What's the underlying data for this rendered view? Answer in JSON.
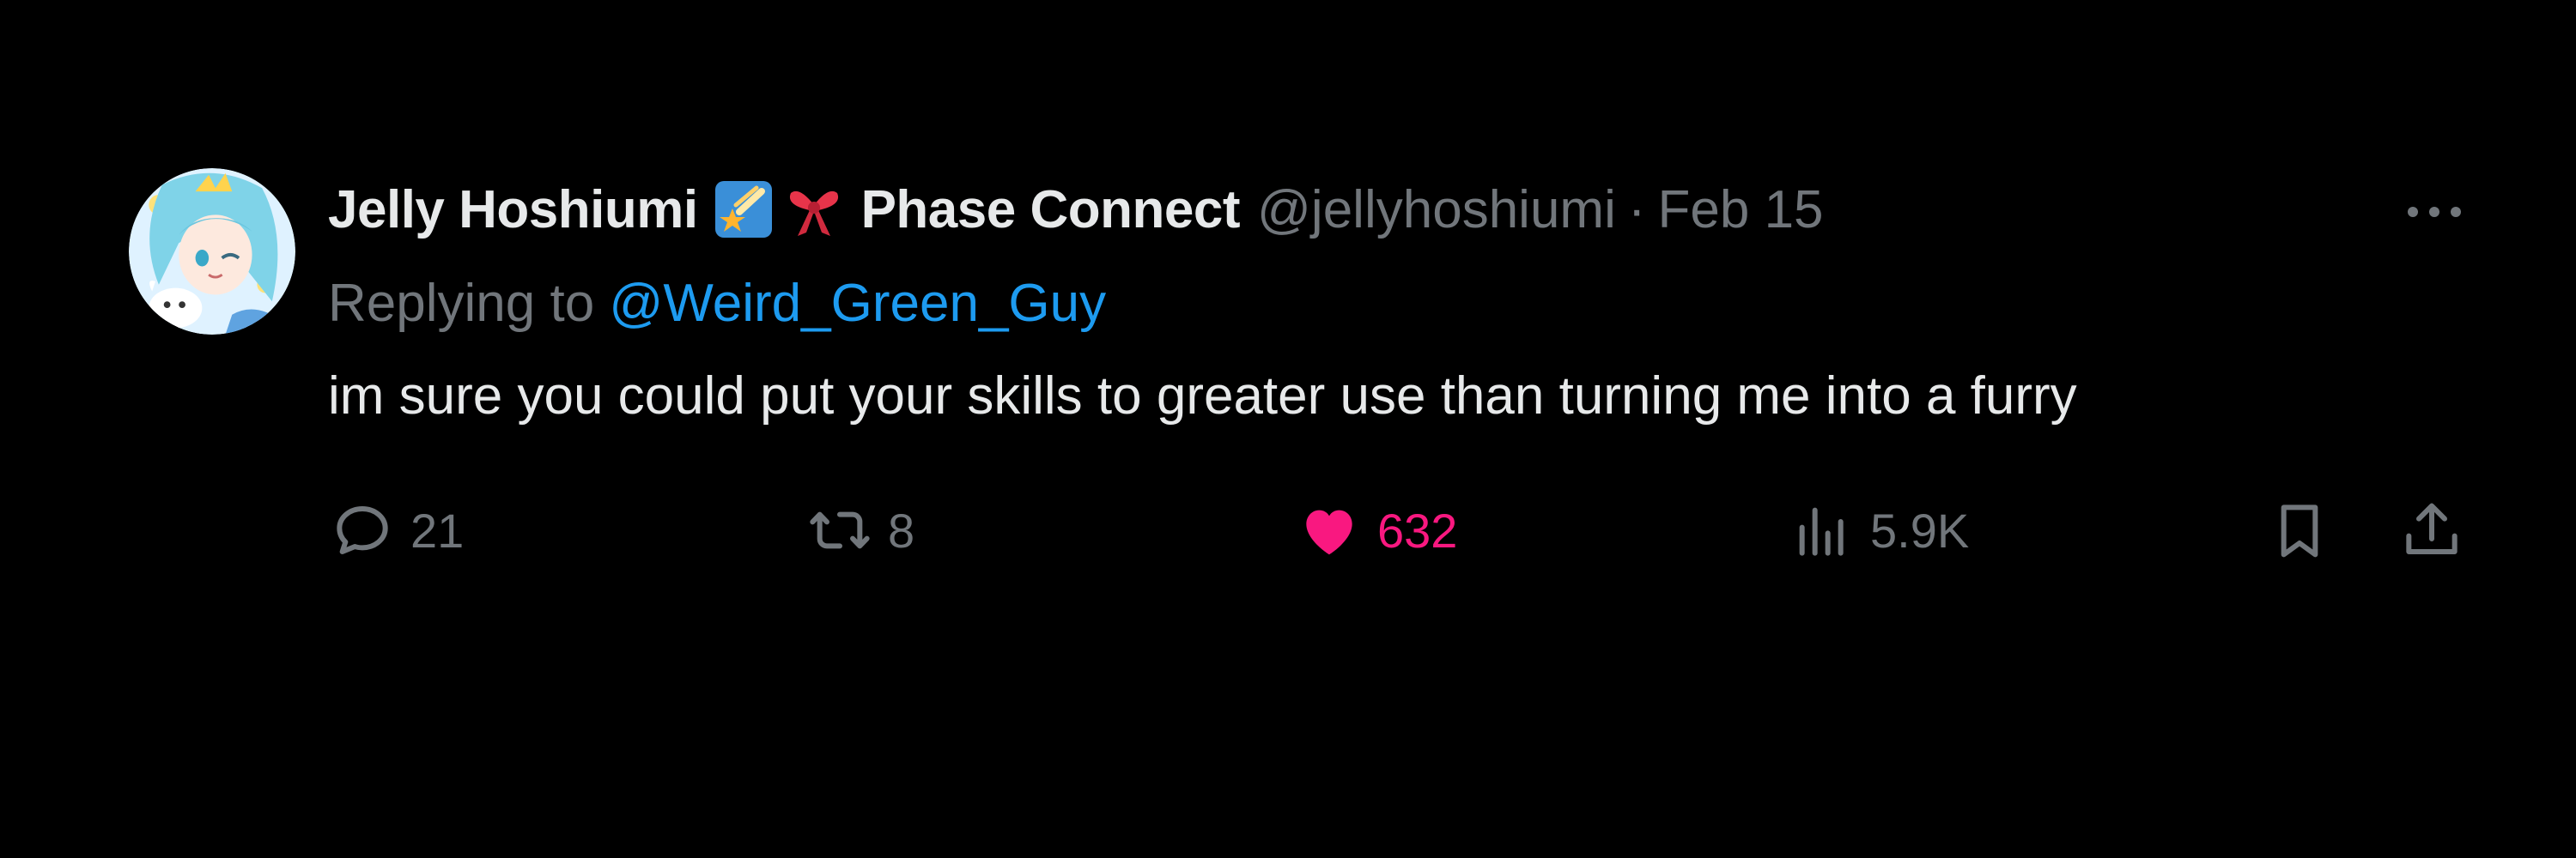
{
  "tweet": {
    "display_name": "Jelly Hoshiumi",
    "badges": [
      "shooting-star-badge-icon",
      "ribbon-badge-icon"
    ],
    "affiliation": "Phase Connect",
    "handle": "@jellyhoshiumi",
    "separator": "·",
    "timestamp": "Feb 15",
    "reply_prefix": "Replying to",
    "reply_to": "@Weird_Green_Guy",
    "text": "im sure you could put your skills to greater use than turning me into a furry"
  },
  "actions": {
    "reply": {
      "icon": "reply-icon",
      "count": "21"
    },
    "retweet": {
      "icon": "retweet-icon",
      "count": "8"
    },
    "like": {
      "icon": "heart-icon",
      "count": "632",
      "liked": true
    },
    "views": {
      "icon": "views-icon",
      "count": "5.9K"
    },
    "bookmark": {
      "icon": "bookmark-icon"
    },
    "share": {
      "icon": "share-icon"
    }
  },
  "colors": {
    "background": "#000000",
    "primary_text": "#e7e9ea",
    "secondary_text": "#71767b",
    "mention": "#1d9bf0",
    "like": "#f91880"
  }
}
